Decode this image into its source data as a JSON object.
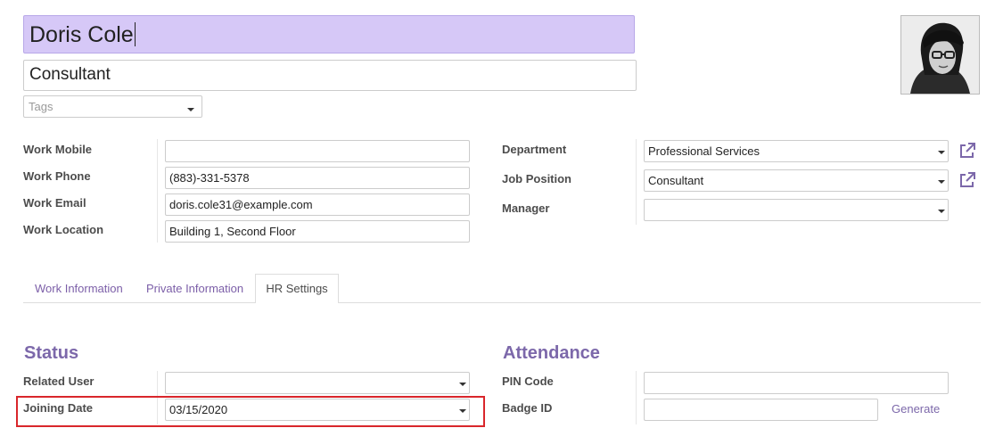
{
  "header": {
    "employee_name": "Doris Cole",
    "job_title": "Consultant",
    "tags_placeholder": "Tags"
  },
  "contact": {
    "work_mobile": {
      "label": "Work Mobile",
      "value": ""
    },
    "work_phone": {
      "label": "Work Phone",
      "value": "(883)-331-5378"
    },
    "work_email": {
      "label": "Work Email",
      "value": "doris.cole31@example.com"
    },
    "work_location": {
      "label": "Work Location",
      "value": "Building 1, Second Floor"
    }
  },
  "org": {
    "department": {
      "label": "Department",
      "value": "Professional Services"
    },
    "job_position": {
      "label": "Job Position",
      "value": "Consultant"
    },
    "manager": {
      "label": "Manager",
      "value": ""
    }
  },
  "tabs": [
    {
      "label": "Work Information"
    },
    {
      "label": "Private Information"
    },
    {
      "label": "HR Settings"
    }
  ],
  "active_tab": "HR Settings",
  "status": {
    "title": "Status",
    "related_user": {
      "label": "Related User",
      "value": ""
    },
    "joining_date": {
      "label": "Joining Date",
      "value": "03/15/2020"
    }
  },
  "attendance": {
    "title": "Attendance",
    "pin_code": {
      "label": "PIN Code",
      "value": ""
    },
    "badge_id": {
      "label": "Badge ID",
      "value": ""
    },
    "generate_label": "Generate"
  },
  "colors": {
    "accent": "#7c68aa",
    "name_highlight": "#d6c8f7",
    "annotation_box": "#d9262b"
  },
  "icons": {
    "external_link": "external-link-icon",
    "dropdown": "chevron-down-icon"
  }
}
